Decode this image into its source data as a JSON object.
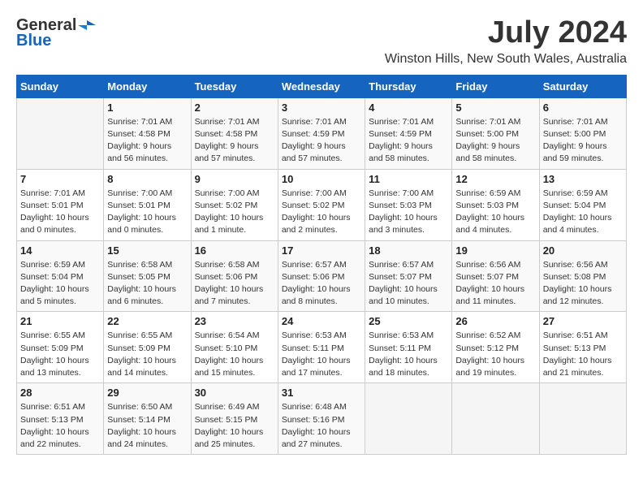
{
  "header": {
    "logo_general": "General",
    "logo_blue": "Blue",
    "month_year": "July 2024",
    "location": "Winston Hills, New South Wales, Australia"
  },
  "calendar": {
    "days_of_week": [
      "Sunday",
      "Monday",
      "Tuesday",
      "Wednesday",
      "Thursday",
      "Friday",
      "Saturday"
    ],
    "weeks": [
      [
        {
          "day": "",
          "info": ""
        },
        {
          "day": "1",
          "info": "Sunrise: 7:01 AM\nSunset: 4:58 PM\nDaylight: 9 hours\nand 56 minutes."
        },
        {
          "day": "2",
          "info": "Sunrise: 7:01 AM\nSunset: 4:58 PM\nDaylight: 9 hours\nand 57 minutes."
        },
        {
          "day": "3",
          "info": "Sunrise: 7:01 AM\nSunset: 4:59 PM\nDaylight: 9 hours\nand 57 minutes."
        },
        {
          "day": "4",
          "info": "Sunrise: 7:01 AM\nSunset: 4:59 PM\nDaylight: 9 hours\nand 58 minutes."
        },
        {
          "day": "5",
          "info": "Sunrise: 7:01 AM\nSunset: 5:00 PM\nDaylight: 9 hours\nand 58 minutes."
        },
        {
          "day": "6",
          "info": "Sunrise: 7:01 AM\nSunset: 5:00 PM\nDaylight: 9 hours\nand 59 minutes."
        }
      ],
      [
        {
          "day": "7",
          "info": "Sunrise: 7:01 AM\nSunset: 5:01 PM\nDaylight: 10 hours\nand 0 minutes."
        },
        {
          "day": "8",
          "info": "Sunrise: 7:00 AM\nSunset: 5:01 PM\nDaylight: 10 hours\nand 0 minutes."
        },
        {
          "day": "9",
          "info": "Sunrise: 7:00 AM\nSunset: 5:02 PM\nDaylight: 10 hours\nand 1 minute."
        },
        {
          "day": "10",
          "info": "Sunrise: 7:00 AM\nSunset: 5:02 PM\nDaylight: 10 hours\nand 2 minutes."
        },
        {
          "day": "11",
          "info": "Sunrise: 7:00 AM\nSunset: 5:03 PM\nDaylight: 10 hours\nand 3 minutes."
        },
        {
          "day": "12",
          "info": "Sunrise: 6:59 AM\nSunset: 5:03 PM\nDaylight: 10 hours\nand 4 minutes."
        },
        {
          "day": "13",
          "info": "Sunrise: 6:59 AM\nSunset: 5:04 PM\nDaylight: 10 hours\nand 4 minutes."
        }
      ],
      [
        {
          "day": "14",
          "info": "Sunrise: 6:59 AM\nSunset: 5:04 PM\nDaylight: 10 hours\nand 5 minutes."
        },
        {
          "day": "15",
          "info": "Sunrise: 6:58 AM\nSunset: 5:05 PM\nDaylight: 10 hours\nand 6 minutes."
        },
        {
          "day": "16",
          "info": "Sunrise: 6:58 AM\nSunset: 5:06 PM\nDaylight: 10 hours\nand 7 minutes."
        },
        {
          "day": "17",
          "info": "Sunrise: 6:57 AM\nSunset: 5:06 PM\nDaylight: 10 hours\nand 8 minutes."
        },
        {
          "day": "18",
          "info": "Sunrise: 6:57 AM\nSunset: 5:07 PM\nDaylight: 10 hours\nand 10 minutes."
        },
        {
          "day": "19",
          "info": "Sunrise: 6:56 AM\nSunset: 5:07 PM\nDaylight: 10 hours\nand 11 minutes."
        },
        {
          "day": "20",
          "info": "Sunrise: 6:56 AM\nSunset: 5:08 PM\nDaylight: 10 hours\nand 12 minutes."
        }
      ],
      [
        {
          "day": "21",
          "info": "Sunrise: 6:55 AM\nSunset: 5:09 PM\nDaylight: 10 hours\nand 13 minutes."
        },
        {
          "day": "22",
          "info": "Sunrise: 6:55 AM\nSunset: 5:09 PM\nDaylight: 10 hours\nand 14 minutes."
        },
        {
          "day": "23",
          "info": "Sunrise: 6:54 AM\nSunset: 5:10 PM\nDaylight: 10 hours\nand 15 minutes."
        },
        {
          "day": "24",
          "info": "Sunrise: 6:53 AM\nSunset: 5:11 PM\nDaylight: 10 hours\nand 17 minutes."
        },
        {
          "day": "25",
          "info": "Sunrise: 6:53 AM\nSunset: 5:11 PM\nDaylight: 10 hours\nand 18 minutes."
        },
        {
          "day": "26",
          "info": "Sunrise: 6:52 AM\nSunset: 5:12 PM\nDaylight: 10 hours\nand 19 minutes."
        },
        {
          "day": "27",
          "info": "Sunrise: 6:51 AM\nSunset: 5:13 PM\nDaylight: 10 hours\nand 21 minutes."
        }
      ],
      [
        {
          "day": "28",
          "info": "Sunrise: 6:51 AM\nSunset: 5:13 PM\nDaylight: 10 hours\nand 22 minutes."
        },
        {
          "day": "29",
          "info": "Sunrise: 6:50 AM\nSunset: 5:14 PM\nDaylight: 10 hours\nand 24 minutes."
        },
        {
          "day": "30",
          "info": "Sunrise: 6:49 AM\nSunset: 5:15 PM\nDaylight: 10 hours\nand 25 minutes."
        },
        {
          "day": "31",
          "info": "Sunrise: 6:48 AM\nSunset: 5:16 PM\nDaylight: 10 hours\nand 27 minutes."
        },
        {
          "day": "",
          "info": ""
        },
        {
          "day": "",
          "info": ""
        },
        {
          "day": "",
          "info": ""
        }
      ]
    ]
  }
}
